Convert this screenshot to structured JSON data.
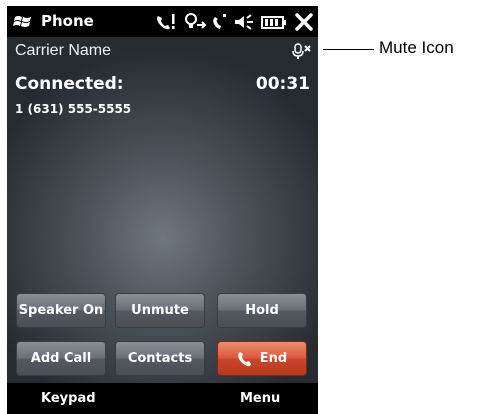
{
  "statusbar": {
    "app_title": "Phone",
    "icons": [
      "windows-logo-icon",
      "call-active-icon",
      "call-forwarding-icon",
      "signal-icon",
      "volume-icon",
      "battery-icon",
      "close-icon"
    ]
  },
  "call": {
    "carrier": "Carrier Name",
    "status": "Connected:",
    "duration": "00:31",
    "number": "1 (631) 555-5555",
    "mute_icon": "microphone-muted-icon"
  },
  "buttons": {
    "speaker": "Speaker On",
    "unmute": "Unmute",
    "hold": "Hold",
    "add_call": "Add Call",
    "contacts": "Contacts",
    "end": "End"
  },
  "softkeys": {
    "left": "Keypad",
    "right": "Menu"
  },
  "annotation": {
    "label": "Mute Icon"
  },
  "colors": {
    "end_button": "#d0503a",
    "button_gray": "#6a6f75",
    "background_dark": "#262b30"
  }
}
